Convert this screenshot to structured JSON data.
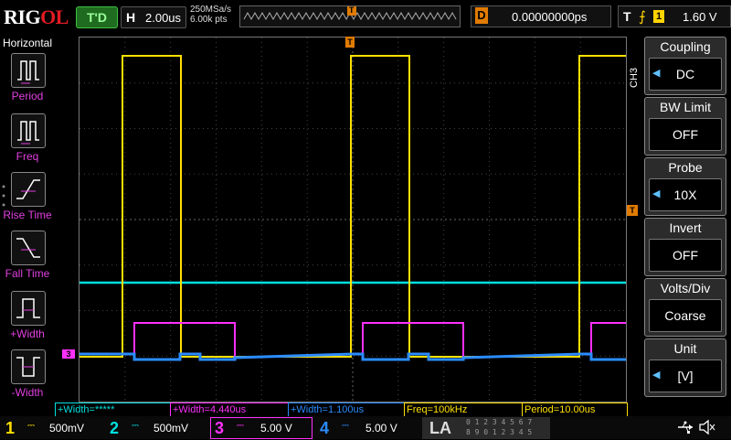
{
  "brand": {
    "name_a": "RIG",
    "name_b": "OL"
  },
  "top": {
    "run_state": "T'D",
    "horizontal_label": "H",
    "timebase": "2.00us",
    "sample_rate": "250MSa/s",
    "memory_depth": "6.00k pts",
    "trigger_marker": "T",
    "delay_label": "D",
    "delay_value": "0.00000000ps",
    "trigger_label": "T",
    "trigger_edge_symbol": "⨍",
    "trigger_source": "1",
    "trigger_level": "1.60 V"
  },
  "left_panel": {
    "title": "Horizontal",
    "items": [
      {
        "label": "Period"
      },
      {
        "label": "Freq"
      },
      {
        "label": "Rise Time"
      },
      {
        "label": "Fall Time"
      },
      {
        "label": "+Width"
      },
      {
        "label": "-Width"
      }
    ]
  },
  "right_panel": {
    "channel_tab": "CH3",
    "items": [
      {
        "title": "Coupling",
        "value": "DC",
        "arrow": "◀"
      },
      {
        "title": "BW Limit",
        "value": "OFF",
        "arrow": ""
      },
      {
        "title": "Probe",
        "value": "10X",
        "arrow": "◀"
      },
      {
        "title": "Invert",
        "value": "OFF",
        "arrow": ""
      },
      {
        "title": "Volts/Div",
        "value": "Coarse",
        "arrow": ""
      },
      {
        "title": "Unit",
        "value": "[V]",
        "arrow": "◀"
      }
    ]
  },
  "measurements": [
    {
      "text": "+Width=*****"
    },
    {
      "text": "+Width=4.440us"
    },
    {
      "text": "+Width=1.100us"
    },
    {
      "text": "Freq=100kHz"
    },
    {
      "text": "Period=10.00us"
    }
  ],
  "channels": [
    {
      "num": "1",
      "value": "500mV",
      "color": "#ffe000"
    },
    {
      "num": "2",
      "value": "500mV",
      "color": "#00e0e0"
    },
    {
      "num": "3",
      "value": "5.00 V",
      "color": "#ff30ff"
    },
    {
      "num": "4",
      "value": "5.00 V",
      "color": "#2b8cff"
    }
  ],
  "la": {
    "label": "LA",
    "row1": "0 1 2 3  4 5 6 7",
    "row2": "8 9 0 1  2 3 4 5"
  },
  "markers": {
    "trigger_level": "T",
    "ch3_ground": "3"
  },
  "colors": {
    "ch1": "#ffe000",
    "ch2": "#00e0e0",
    "ch3": "#ff30ff",
    "ch4": "#2b8cff",
    "accent": "#e07b00"
  }
}
